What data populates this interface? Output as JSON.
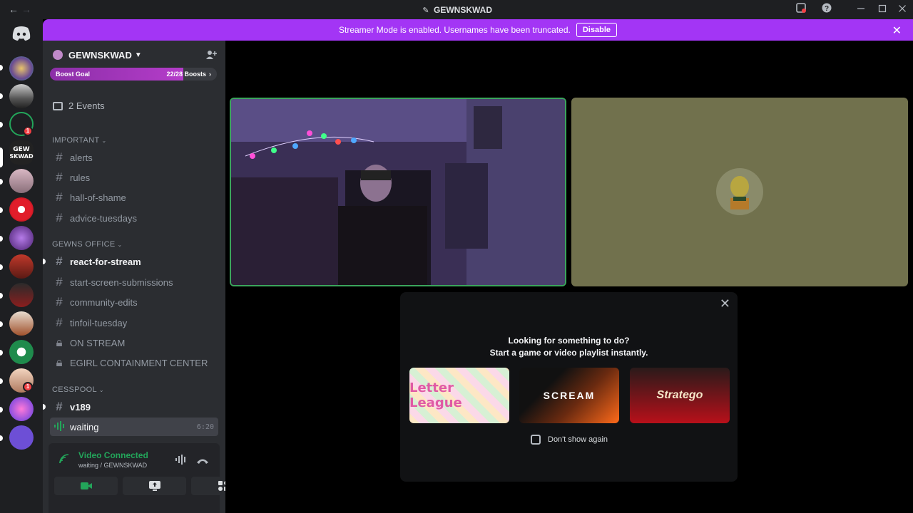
{
  "window": {
    "title": "GEWNSKWAD",
    "back_glyph": "←",
    "forward_glyph": "→"
  },
  "streamer_bar": {
    "message": "Streamer Mode is enabled. Usernames have been truncated.",
    "disable_label": "Disable"
  },
  "guild_rail": {
    "badges": [
      "1",
      "1"
    ]
  },
  "server": {
    "name": "GEWNSKWAD",
    "boost_label": "Boost Goal",
    "boost_progress": "22/28 Boosts",
    "boost_fraction": 0.786,
    "events_label": "2 Events"
  },
  "categories": {
    "important": "IMPORTANT",
    "office": "GEWNS OFFICE",
    "cesspool": "CESSPOOL"
  },
  "channels": {
    "alerts": "alerts",
    "rules": "rules",
    "hall_of_shame": "hall-of-shame",
    "advice_tuesdays": "advice-tuesdays",
    "react_for_stream": "react-for-stream",
    "start_screen": "start-screen-submissions",
    "community_edits": "community-edits",
    "tinfoil_tuesday": "tinfoil-tuesday",
    "on_stream": "ON STREAM",
    "egirl": "EGIRL CONTAINMENT CENTER",
    "v189": "v189",
    "waiting": "waiting",
    "waiting_time": "6:20"
  },
  "voice": {
    "status": "Video Connected",
    "location": "waiting / GEWNSKWAD"
  },
  "activity": {
    "line1": "Looking for something to do?",
    "line2": "Start a game or video playlist instantly.",
    "cards": [
      "Letter League",
      "SCREAM",
      "Stratego"
    ],
    "dont_show": "Don't show again"
  },
  "colors": {
    "accent_purple": "#a335f5",
    "online_green": "#23a55a",
    "sidebar_bg": "#2b2d31"
  }
}
